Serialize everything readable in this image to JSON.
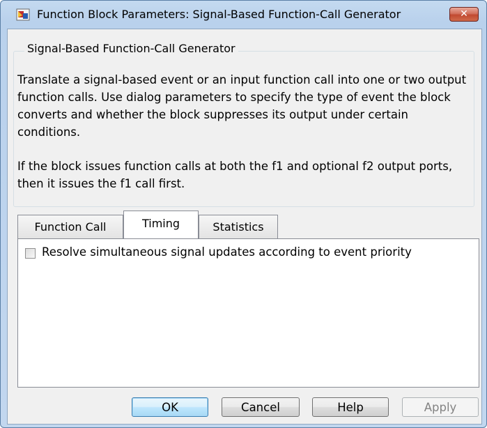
{
  "window": {
    "title": "Function Block Parameters: Signal-Based Function-Call Generator",
    "app_icon": "simulink-block-icon",
    "close_label": "✕"
  },
  "group": {
    "title": "Signal-Based Function-Call Generator",
    "paragraphs": [
      "Translate a signal-based event or an input function call into one or two output function calls. Use dialog parameters to specify the type of event the block converts and whether the block suppresses its output under certain conditions.",
      "If the block issues function calls at both the f1 and optional f2 output ports, then it issues the f1 call first."
    ]
  },
  "tabs": [
    {
      "label": "Function Call",
      "active": false
    },
    {
      "label": "Timing",
      "active": true
    },
    {
      "label": "Statistics",
      "active": false
    }
  ],
  "timing_panel": {
    "checkbox_label": "Resolve simultaneous signal updates according to event priority",
    "checked": false
  },
  "buttons": {
    "ok": "OK",
    "cancel": "Cancel",
    "help": "Help",
    "apply": "Apply"
  }
}
